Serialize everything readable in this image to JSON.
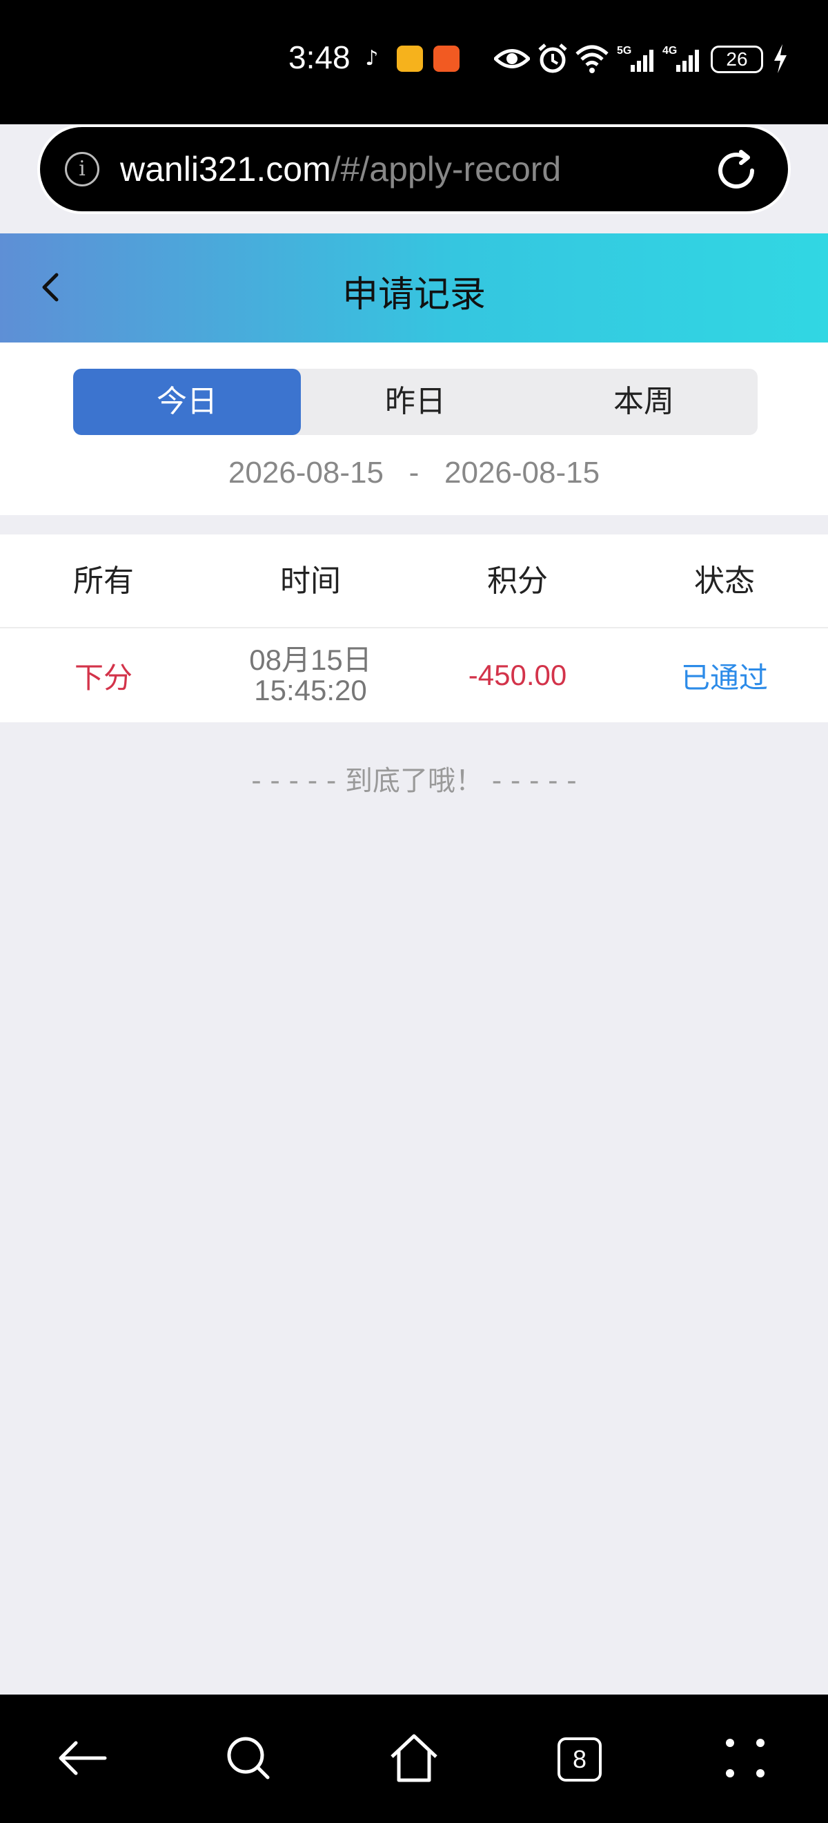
{
  "status_bar": {
    "time": "3:48",
    "battery": "26",
    "network_labels": [
      "5G",
      "4G"
    ]
  },
  "browser": {
    "url_host": "wanli321.com",
    "url_path": "/#/apply-record",
    "tab_count": "8"
  },
  "header": {
    "title": "申请记录"
  },
  "filters": {
    "tabs": [
      {
        "label": "今日",
        "active": true
      },
      {
        "label": "昨日",
        "active": false
      },
      {
        "label": "本周",
        "active": false
      }
    ],
    "date_from": "2026-08-15",
    "date_separator": "-",
    "date_to": "2026-08-15"
  },
  "table": {
    "columns": [
      "所有",
      "时间",
      "积分",
      "状态"
    ],
    "rows": [
      {
        "type": "下分",
        "date": "08月15日",
        "time": "15:45:20",
        "points": "-450.00",
        "status": "已通过"
      }
    ]
  },
  "end_note": "- - - - - 到底了哦！ - - - - -",
  "colors": {
    "header_gradient_start": "#5e8fd6",
    "header_gradient_end": "#31d7e3",
    "active_tab": "#3c74cf",
    "negative": "#d3334a",
    "status_ok": "#2c8be8",
    "page_bg": "#eeeef3"
  }
}
